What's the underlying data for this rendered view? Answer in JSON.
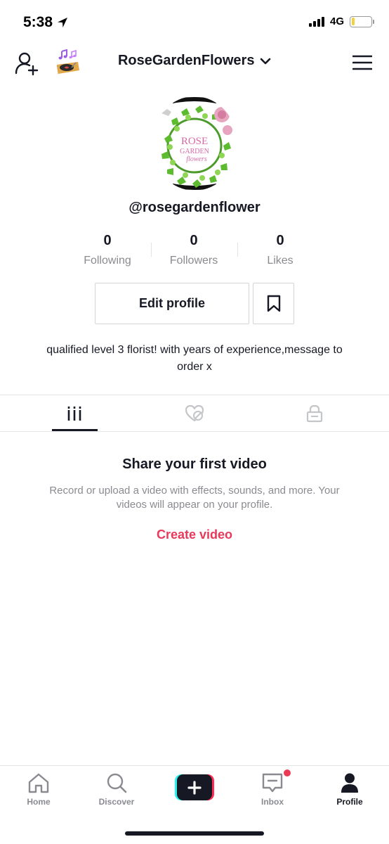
{
  "status": {
    "time": "5:38",
    "network": "4G",
    "battery_level": 0.15
  },
  "header": {
    "account_name": "RoseGardenFlowers"
  },
  "profile": {
    "handle": "@rosegardenflower",
    "avatar_text_1": "ROSE",
    "avatar_text_2": "GARDEN",
    "avatar_text_3": "flowers",
    "bio": "qualified level 3 florist! with years of experience,message to order x"
  },
  "stats": [
    {
      "value": "0",
      "label": "Following"
    },
    {
      "value": "0",
      "label": "Followers"
    },
    {
      "value": "0",
      "label": "Likes"
    }
  ],
  "actions": {
    "edit_profile": "Edit profile"
  },
  "tabs": [
    "videos-grid-icon",
    "liked-private-icon",
    "lock-icon"
  ],
  "empty_state": {
    "title": "Share your first video",
    "description": "Record or upload a video with effects, sounds, and more. Your videos will appear on your profile.",
    "cta": "Create video"
  },
  "nav": [
    {
      "label": "Home"
    },
    {
      "label": "Discover"
    },
    {
      "label": "Inbox"
    },
    {
      "label": "Profile"
    }
  ],
  "colors": {
    "accent": "#e8395a",
    "cyan": "#25f4ee",
    "red": "#fe2c55",
    "text": "#161823",
    "muted": "#8a8b91"
  }
}
